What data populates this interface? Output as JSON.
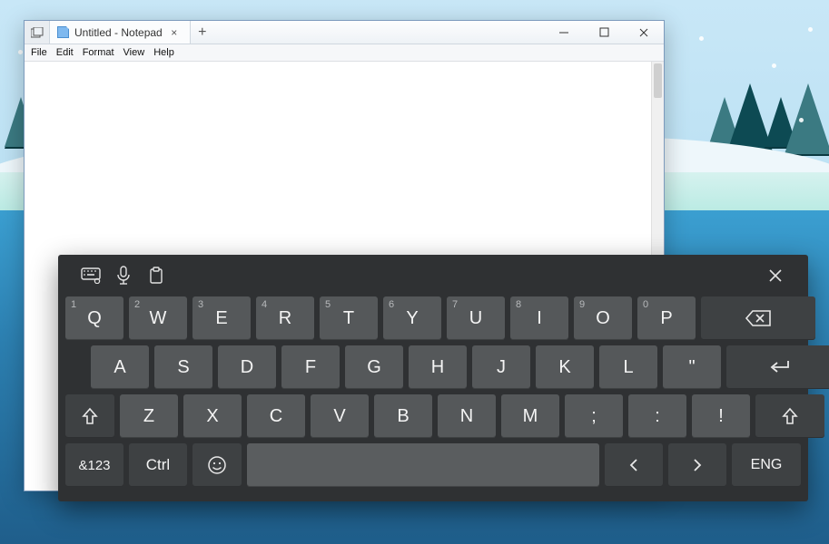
{
  "notepad": {
    "tab_title": "Untitled - Notepad",
    "tab_close": "×",
    "new_tab": "+",
    "menu": {
      "file": "File",
      "edit": "Edit",
      "format": "Format",
      "view": "View",
      "help": "Help"
    },
    "content": ""
  },
  "osk": {
    "toolbar": {
      "settings": "keyboard-settings-icon",
      "mic": "microphone-icon",
      "paste": "clipboard-icon",
      "close": "×"
    },
    "row1_sup": [
      "1",
      "2",
      "3",
      "4",
      "5",
      "6",
      "7",
      "8",
      "9",
      "0"
    ],
    "row1": [
      "Q",
      "W",
      "E",
      "R",
      "T",
      "Y",
      "U",
      "I",
      "O",
      "P"
    ],
    "backspace": "⌫",
    "row2": [
      "A",
      "S",
      "D",
      "F",
      "G",
      "H",
      "J",
      "K",
      "L",
      "\""
    ],
    "enter": "↵",
    "row3": [
      "Z",
      "X",
      "C",
      "V",
      "B",
      "N",
      "M",
      ";",
      ":",
      "!"
    ],
    "shift": "↑",
    "row4": {
      "sym": "&123",
      "ctrl": "Ctrl",
      "emoji": "☺",
      "left": "‹",
      "right": "›",
      "lang": "ENG"
    }
  }
}
